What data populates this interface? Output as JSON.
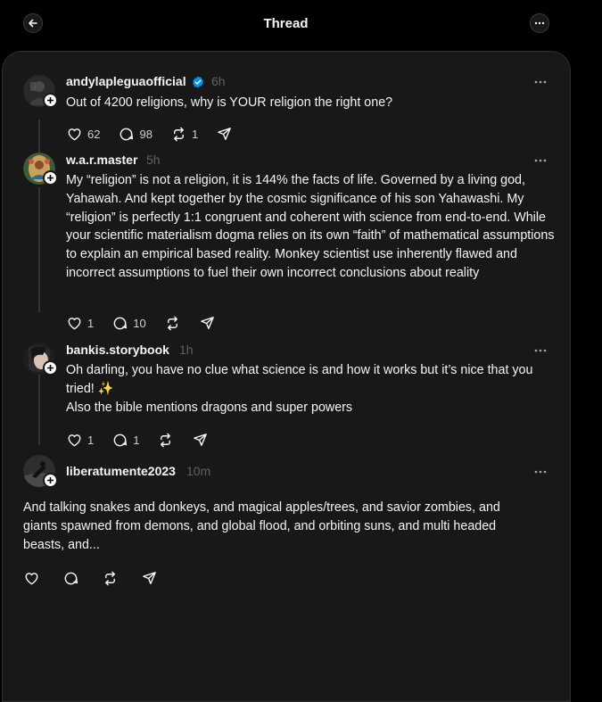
{
  "header": {
    "title": "Thread"
  },
  "posts": [
    {
      "username": "andylapleguaofficial",
      "verified": true,
      "time": "6h",
      "text": "Out of 4200 religions, why is YOUR religion the right one?",
      "likes": "62",
      "replies": "98",
      "reposts": "1"
    },
    {
      "username": "w.a.r.master",
      "time": "5h",
      "text": "My “religion” is not a religion, it is 144% the facts of life. Governed by a living god, Yahawah. And kept together by the cosmic significance of his son Yahawashi. My “religion” is perfectly 1:1 congruent and coherent with science from end-to-end. While your scientific materialism dogma relies on its own “faith” of mathematical assumptions to explain an empirical based reality. Monkey scientist use inherently flawed and incorrect assumptions to fuel their own incorrect conclusions about reality",
      "likes": "1",
      "replies": "10"
    },
    {
      "username": "bankis.storybook",
      "time": "1h",
      "text": "Oh darling, you have no clue what science is and how it works but it’s nice that you tried! ✨\nAlso the bible mentions dragons and super powers",
      "likes": "1",
      "replies": "1"
    },
    {
      "username": "liberatumente2023",
      "time": "10m",
      "text": "And talking snakes and donkeys, and magical apples/trees, and savior zombies, and giants spawned from demons, and global flood, and orbiting suns, and multi headed beasts, and..."
    }
  ],
  "colors": {
    "background": "#000000",
    "panel": "#181818",
    "text": "#f3f5f7",
    "muted": "#616161",
    "verified": "#0095f6"
  },
  "icons": [
    "back-arrow-icon",
    "more-icon",
    "verified-icon",
    "heart-icon",
    "comment-icon",
    "repost-icon",
    "share-icon",
    "plus-icon"
  ]
}
